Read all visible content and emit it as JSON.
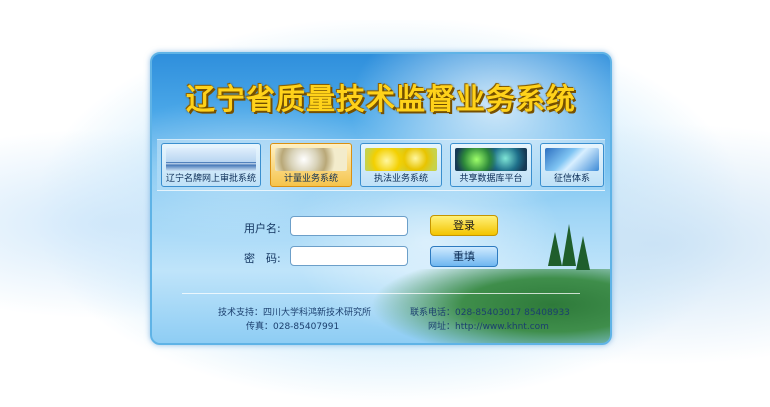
{
  "header": {
    "title": "辽宁省质量技术监督业务系统"
  },
  "tabs": [
    {
      "label": "辽宁名牌网上审批系统",
      "active": false,
      "icon": "people-walkway-image"
    },
    {
      "label": "计量业务系统",
      "active": true,
      "icon": "gears-ruler-image"
    },
    {
      "label": "执法业务系统",
      "active": false,
      "icon": "yellow-bubbles-image"
    },
    {
      "label": "共享数据库平台",
      "active": false,
      "icon": "green-cells-image"
    },
    {
      "label": "征信体系",
      "active": false,
      "icon": "blue-lights-image"
    }
  ],
  "login": {
    "username_label": "用户名:",
    "username_value": "",
    "username_placeholder": "",
    "password_label": "密　码:",
    "password_value": "",
    "password_placeholder": "",
    "login_button": "登录",
    "reset_button": "重填"
  },
  "footer": {
    "support": "技术支持：四川大学科鸿新技术研究所",
    "fax": "传真：028-85407991",
    "phone": "联系电话：028-85403017  85408933",
    "website": "网址：http://www.khnt.com"
  },
  "colors": {
    "title": "#ffd21a",
    "login_button": "#f3c400",
    "reset_button": "#6fb6f0",
    "active_tab": "#f5c44b"
  }
}
